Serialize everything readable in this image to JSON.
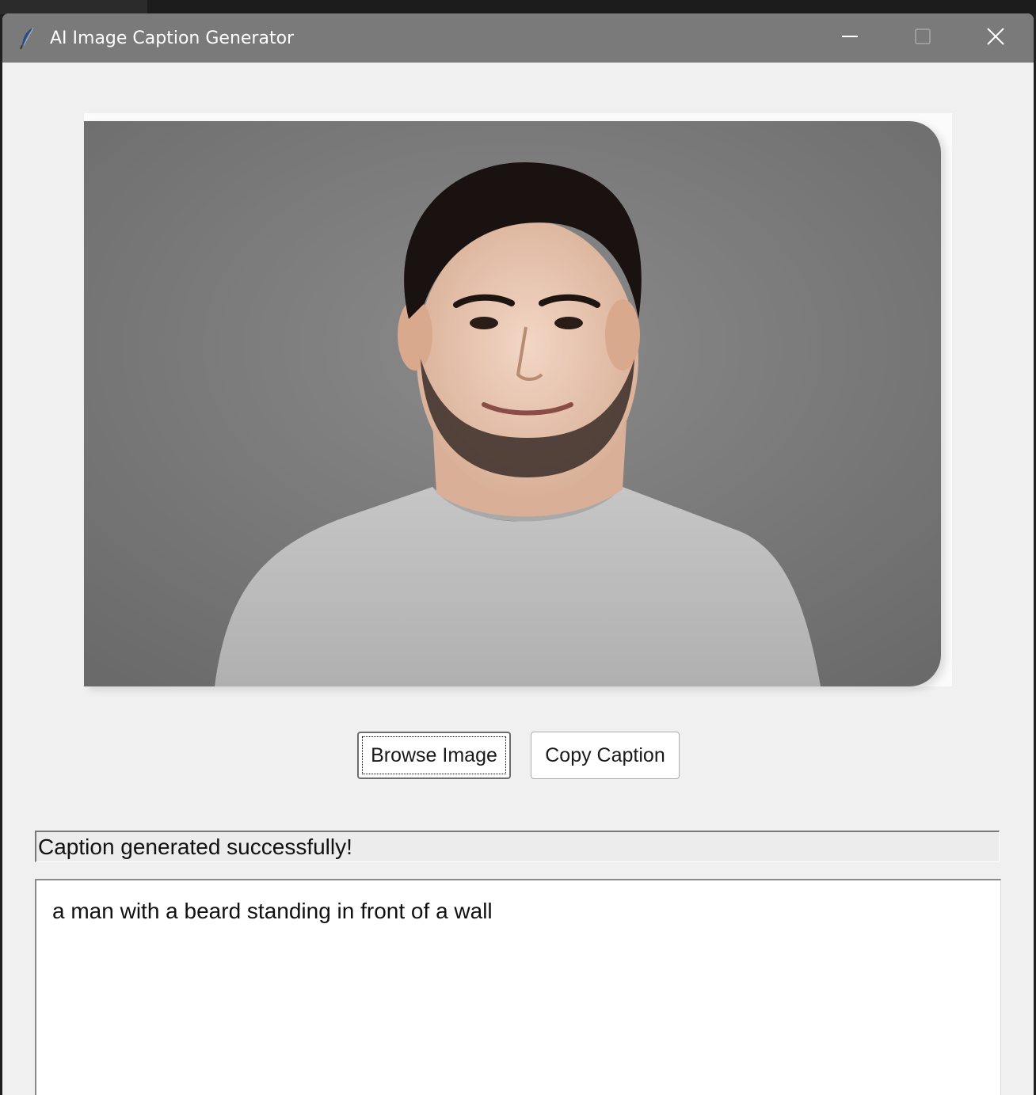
{
  "window": {
    "title": "AI Image Caption Generator",
    "icon": "feather-icon"
  },
  "controls": {
    "minimize_icon": "minimize-icon",
    "maximize_icon": "maximize-icon",
    "close_icon": "close-icon"
  },
  "image": {
    "subject": "portrait-photo"
  },
  "buttons": {
    "browse_label": "Browse Image",
    "copy_label": "Copy Caption"
  },
  "status": {
    "text": "Caption generated successfully!"
  },
  "caption": {
    "text": "a man with a beard standing in front of a wall"
  },
  "colors": {
    "titlebar": "#7a7a7a",
    "window_bg": "#f0f0f0",
    "photo_bg": "#7d7d7d"
  }
}
